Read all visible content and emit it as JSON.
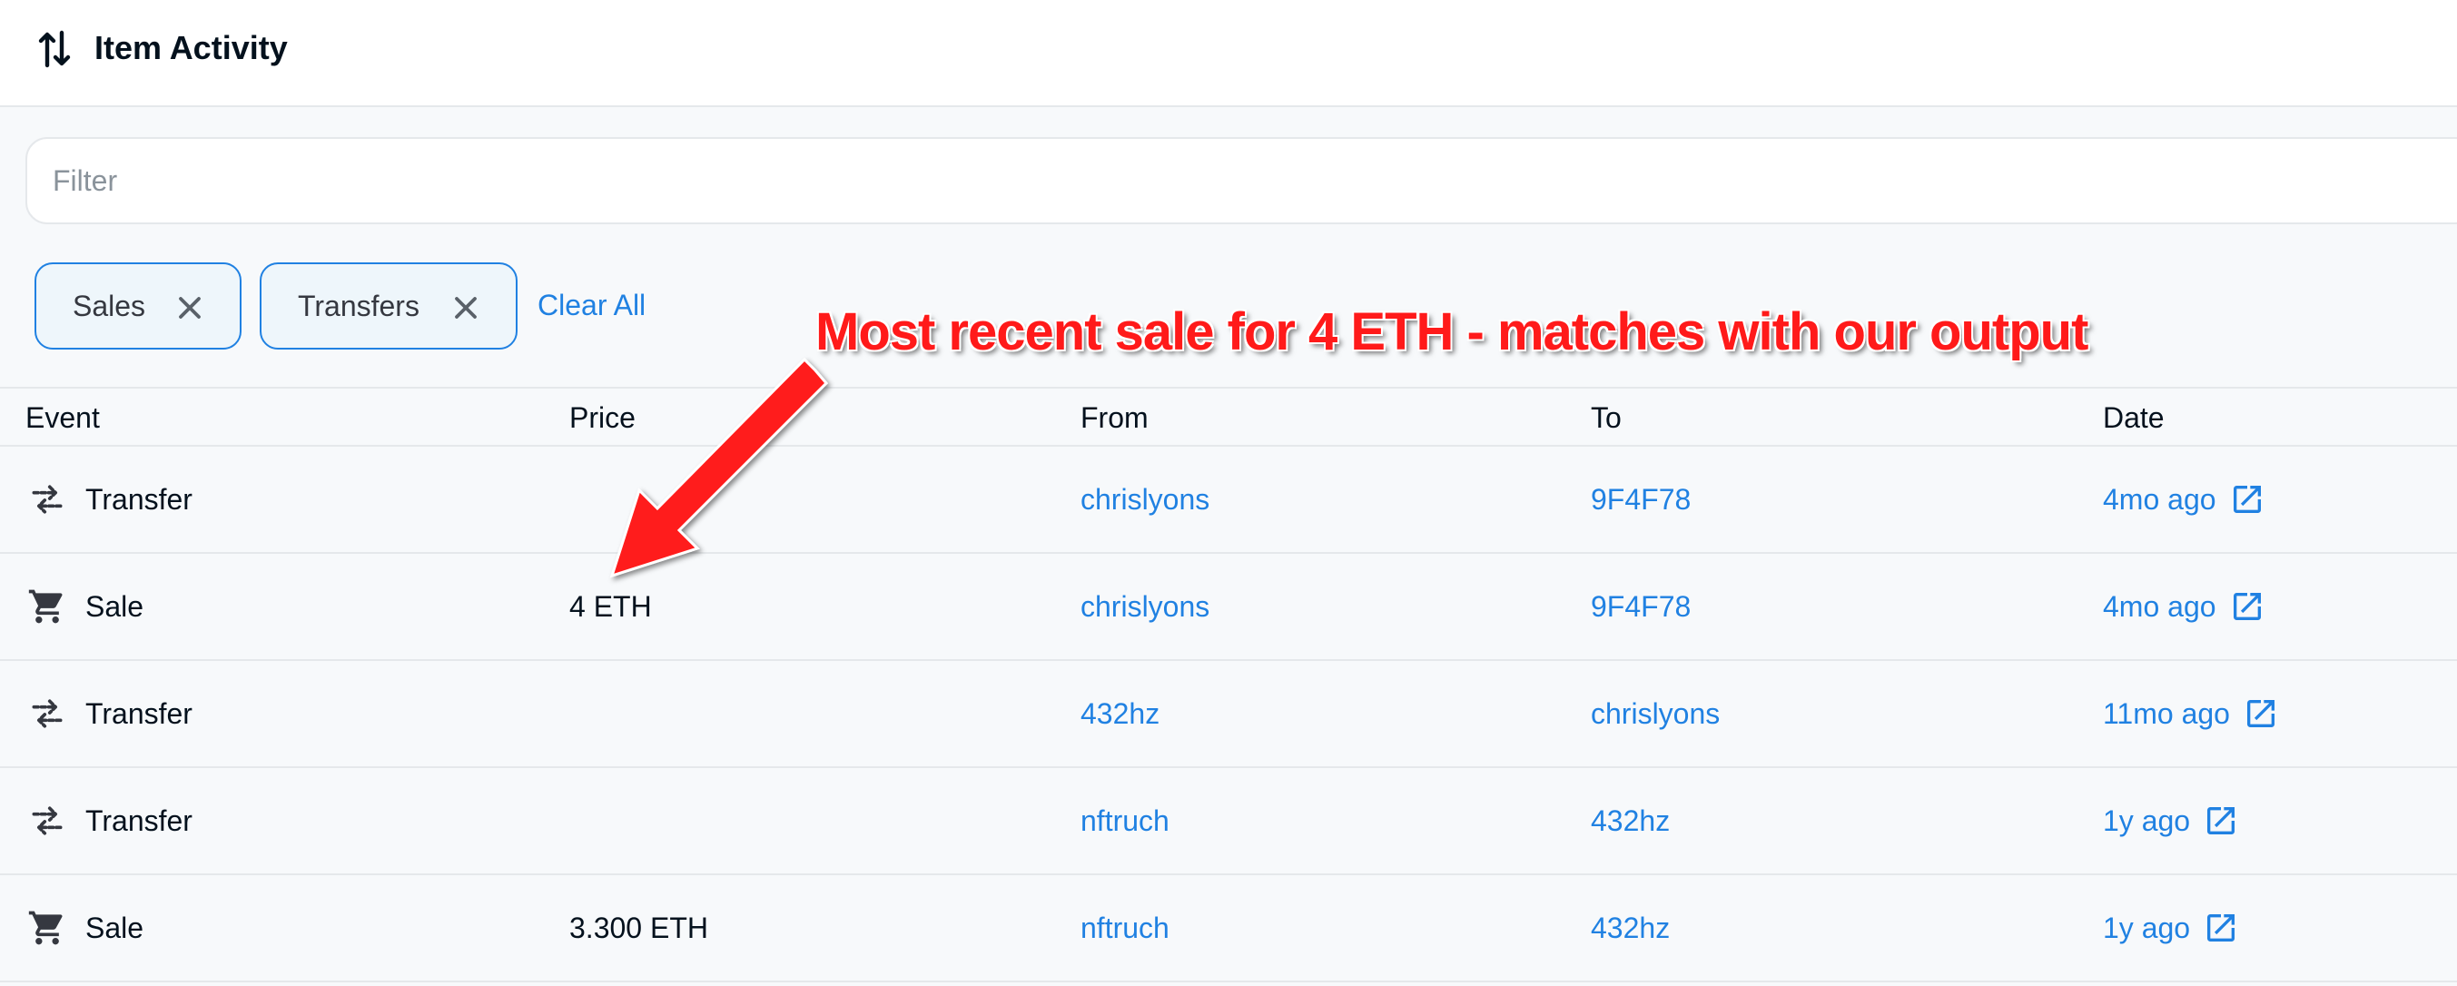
{
  "header": {
    "title": "Item Activity",
    "icon": "sort-arrows-icon"
  },
  "filter": {
    "placeholder": "Filter",
    "value": ""
  },
  "chips": [
    {
      "label": "Sales",
      "icon": "close-icon"
    },
    {
      "label": "Transfers",
      "icon": "close-icon"
    }
  ],
  "clear_all_label": "Clear All",
  "table": {
    "columns": [
      "Event",
      "Price",
      "From",
      "To",
      "Date"
    ],
    "rows": [
      {
        "event": "Transfer",
        "event_icon": "transfer-icon",
        "price": "",
        "from": "chrislyons",
        "to": "9F4F78",
        "date": "4mo ago"
      },
      {
        "event": "Sale",
        "event_icon": "cart-icon",
        "price": "4 ETH",
        "from": "chrislyons",
        "to": "9F4F78",
        "date": "4mo ago"
      },
      {
        "event": "Transfer",
        "event_icon": "transfer-icon",
        "price": "",
        "from": "432hz",
        "to": "chrislyons",
        "date": "11mo ago"
      },
      {
        "event": "Transfer",
        "event_icon": "transfer-icon",
        "price": "",
        "from": "nftruch",
        "to": "432hz",
        "date": "1y ago"
      },
      {
        "event": "Sale",
        "event_icon": "cart-icon",
        "price": "3.300 ETH",
        "from": "nftruch",
        "to": "432hz",
        "date": "1y ago"
      }
    ]
  },
  "annotation": {
    "text": "Most recent sale for 4 ETH - matches with our output",
    "color": "#ff1a1a"
  },
  "colors": {
    "accent": "#2081e2",
    "text": "#04111d",
    "border": "#e5e8eb",
    "background": "#f7f9fb"
  }
}
